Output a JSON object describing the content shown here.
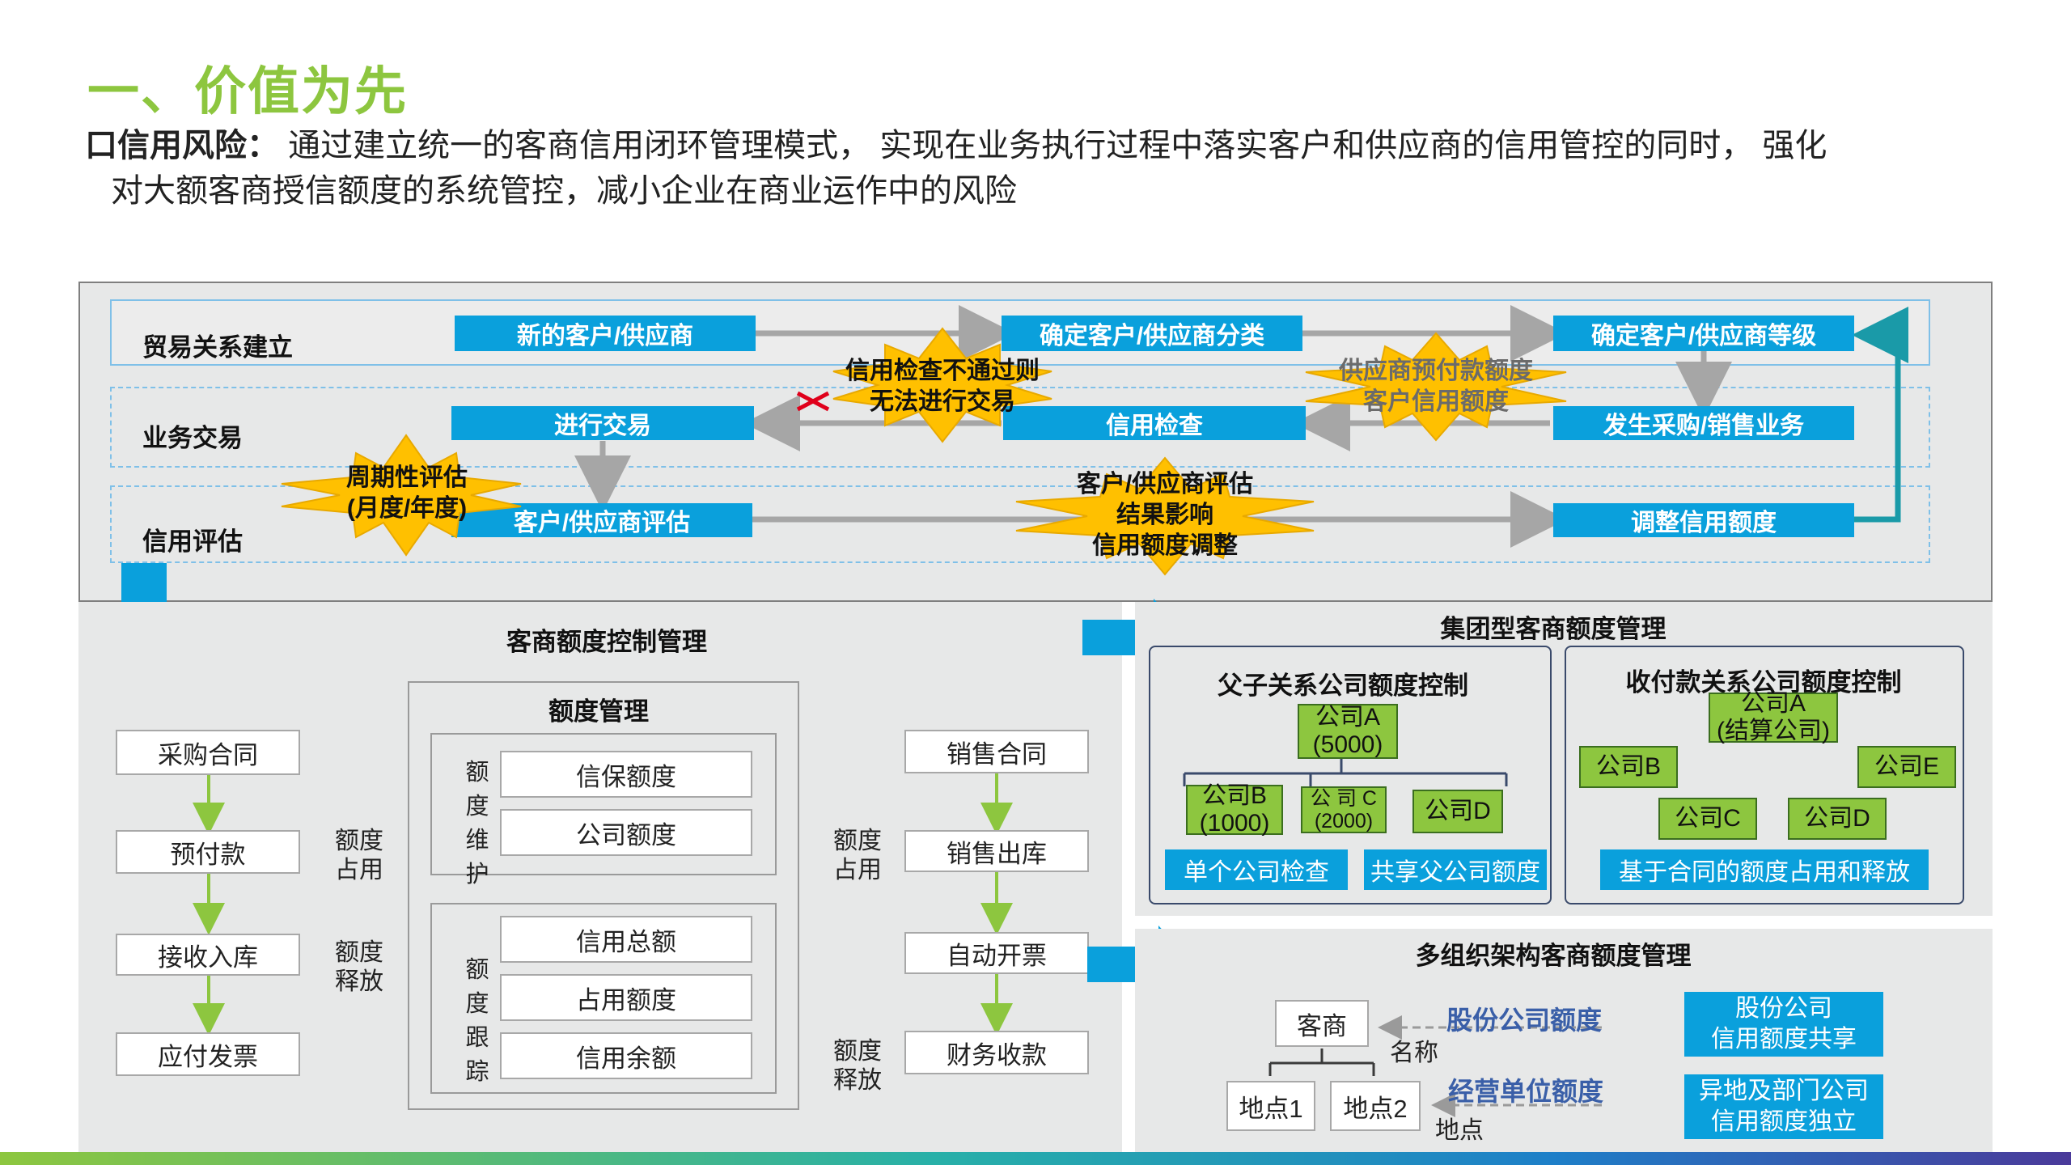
{
  "title": "一、价值为先",
  "intro": {
    "lead": "口信用风险：",
    "line1": "  通过建立统一的客商信用闭环管理模式，  实现在业务执行过程中落实客户和供应商的信用管控的同时，  强化",
    "line2": "对大额客商授信额度的系统管控，减小企业在商业运作中的风险"
  },
  "flow": {
    "rows": [
      "贸易关系建立",
      "业务交易",
      "信用评估"
    ],
    "boxes": {
      "new_partner": "新的客户/供应商",
      "classify": "确定客户/供应商分类",
      "grade": "确定客户/供应商等级",
      "trade": "进行交易",
      "credit_check": "信用检查",
      "purchase_sales": "发生采购/销售业务",
      "evaluate": "客户/供应商评估",
      "adjust": "调整信用额度"
    },
    "stars": {
      "fail": [
        "信用检查不通过则",
        "无法进行交易"
      ],
      "limit": [
        "供应商预付款额度",
        "客户信用额度"
      ],
      "period": [
        "周期性评估",
        "(月度/年度)"
      ],
      "result": [
        "客户/供应商评估",
        "结果影响",
        "信用额度调整"
      ]
    }
  },
  "quota_mgmt": {
    "title": "客商额度控制管理",
    "purchase": [
      "采购合同",
      "预付款",
      "接收入库",
      "应付发票"
    ],
    "sales": [
      "销售合同",
      "销售出库",
      "自动开票",
      "财务收款"
    ],
    "occupy": [
      "额度",
      "占用"
    ],
    "release": [
      "额度",
      "释放"
    ],
    "center_title": "额度管理",
    "maintain_chars": [
      "额",
      "度",
      "维",
      "护"
    ],
    "maintain_items": [
      "信保额度",
      "公司额度"
    ],
    "track_chars": [
      "额",
      "度",
      "跟",
      "踪"
    ],
    "track_items": [
      "信用总额",
      "占用额度",
      "信用余额"
    ]
  },
  "group": {
    "title": "集团型客商额度管理",
    "parent": {
      "title": "父子关系公司额度控制",
      "a": [
        "公司A",
        "(5000)"
      ],
      "b": [
        "公司B",
        "(1000)"
      ],
      "c": [
        "公 司 C",
        "(2000)"
      ],
      "d": "公司D",
      "btn1": "单个公司检查",
      "btn2": "共享父公司额度"
    },
    "payment": {
      "title": "收付款关系公司额度控制",
      "a": [
        "公司A",
        "(结算公司)"
      ],
      "b": "公司B",
      "c": "公司C",
      "d": "公司D",
      "e": "公司E",
      "btn": "基于合同的额度占用和释放"
    }
  },
  "multi_org": {
    "title": "多组织架构客商额度管理",
    "partner": "客商",
    "site1": "地点1",
    "site2": "地点2",
    "share_label": "股份公司额度",
    "name_label": "名称",
    "unit_label": "经营单位额度",
    "site_label": "地点",
    "box1": [
      "股份公司",
      "信用额度共享"
    ],
    "box2": [
      "异地及部门公司",
      "信用额度独立"
    ]
  },
  "colors": {
    "title_green": "#8dc63f",
    "box_blue": "#0aa0dc",
    "star_yellow": "#ffc000",
    "company_green": "#8dc63f"
  }
}
